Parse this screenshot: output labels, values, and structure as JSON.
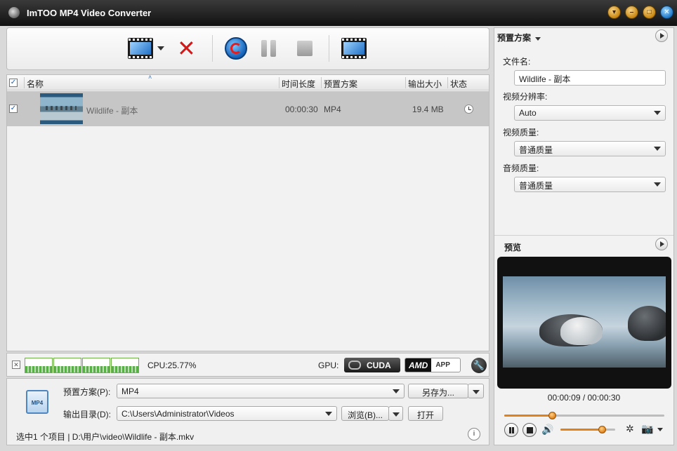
{
  "window": {
    "title": "ImTOO MP4 Video Converter",
    "controls": [
      "minimize-alt",
      "minimize",
      "maximize",
      "close"
    ]
  },
  "toolbar": {
    "buttons": [
      "add-video-icon",
      "remove-icon",
      "convert-icon",
      "pause-icon",
      "stop-icon",
      "export-icon"
    ]
  },
  "file_list": {
    "headers": {
      "name": "名称",
      "duration": "时间长度",
      "profile": "预置方案",
      "output_size": "输出大小",
      "status": "状态"
    },
    "rows": [
      {
        "checked": true,
        "name": "Wildlife - 副本",
        "duration": "00:00:30",
        "profile": "MP4",
        "size": "19.4 MB",
        "status_icon": "clock-icon"
      }
    ]
  },
  "cpu": {
    "label": "CPU:25.77%",
    "gpu_label": "GPU:",
    "cuda": "CUDA",
    "amd": "AMD",
    "app": "APP"
  },
  "bottom": {
    "profile_label": "预置方案(P):",
    "profile_value": "MP4",
    "save_as": "另存为...",
    "output_label": "输出目录(D):",
    "output_value": "C:\\Users\\Administrator\\Videos",
    "browse": "浏览(B)...",
    "open": "打开",
    "status_text": "选中1 个项目 | D:\\用户\\video\\Wildlife - 副本.mkv"
  },
  "right_panel": {
    "header": "预置方案",
    "filename_label": "文件名:",
    "filename_value": "Wildlife - 副本",
    "resolution_label": "视频分辨率:",
    "resolution_value": "Auto",
    "video_quality_label": "视频质量:",
    "video_quality_value": "普通质量",
    "audio_quality_label": "音频质量:",
    "audio_quality_value": "普通质量",
    "preview_label": "预览",
    "time_text": "00:00:09 / 00:00:30",
    "progress": 0.3,
    "volume": 0.75
  }
}
